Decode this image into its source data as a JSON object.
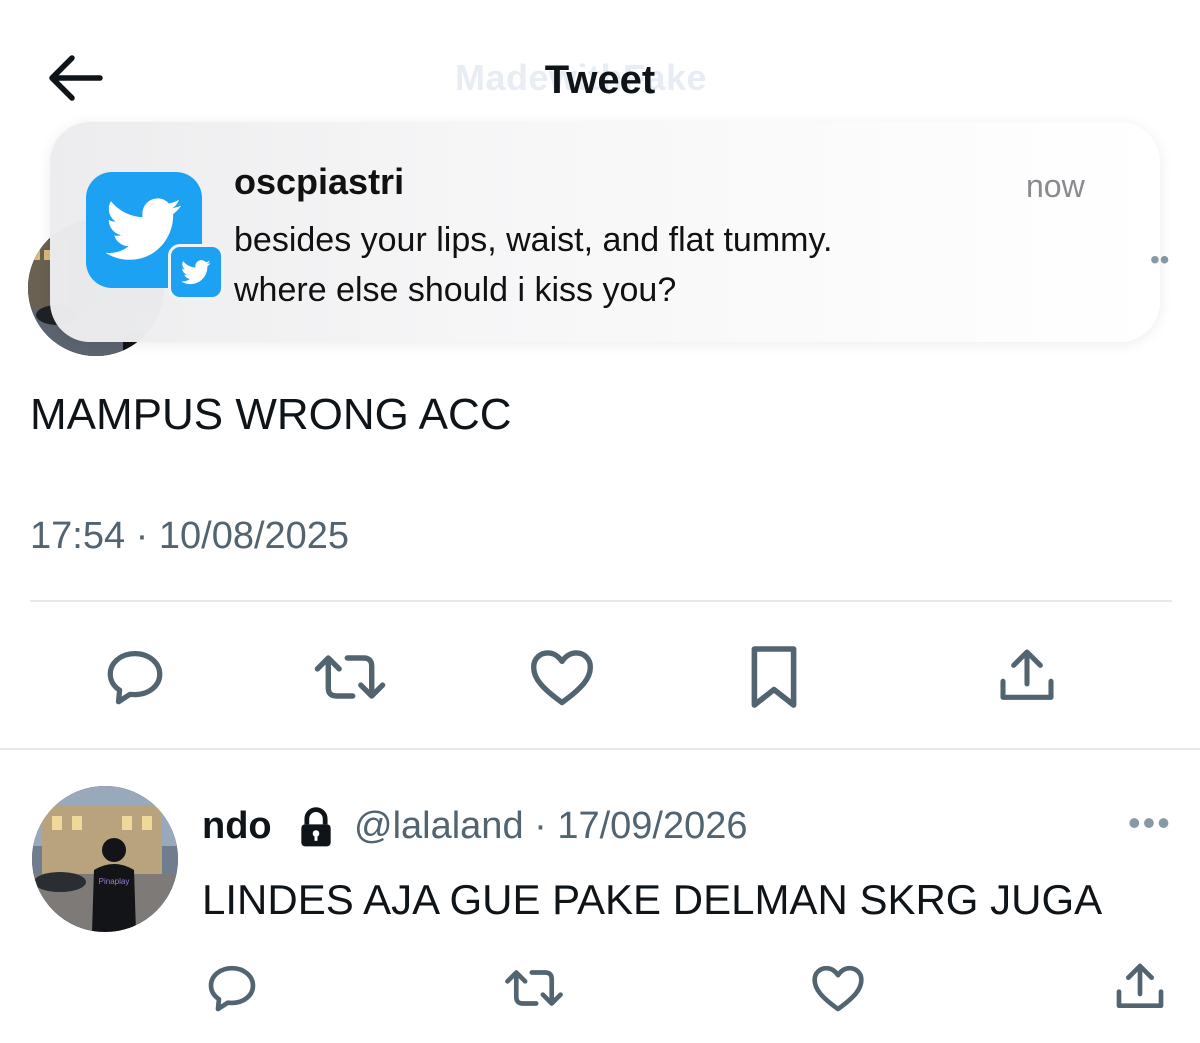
{
  "header": {
    "title": "Tweet",
    "watermark": "MadewithFake"
  },
  "notification": {
    "app_name": "oscpiastri",
    "time": "now",
    "line1": "besides your lips, waist, and flat tummy.",
    "line2": "where else should i kiss you?"
  },
  "tweet": {
    "text": "MAMPUS WRONG ACC",
    "meta": "17:54 · 10/08/2025",
    "more": "• •"
  },
  "reply": {
    "name": "ndo",
    "handle_date": "@lalaland · 17/09/2026",
    "text": "LINDES AJA GUE PAKE DELMAN SKRG JUGA",
    "more": "•••",
    "hoodie_text": "Pinaplay"
  },
  "colors": {
    "text": "#0f1419",
    "secondary": "#536471",
    "icon": "#536471",
    "twitter_blue": "#1da1f2",
    "divider": "#e4e9ec"
  },
  "icons": [
    "back-arrow-icon",
    "twitter-bird-icon",
    "reply-icon",
    "retweet-icon",
    "like-icon",
    "bookmark-icon",
    "share-icon",
    "lock-icon",
    "more-icon"
  ]
}
